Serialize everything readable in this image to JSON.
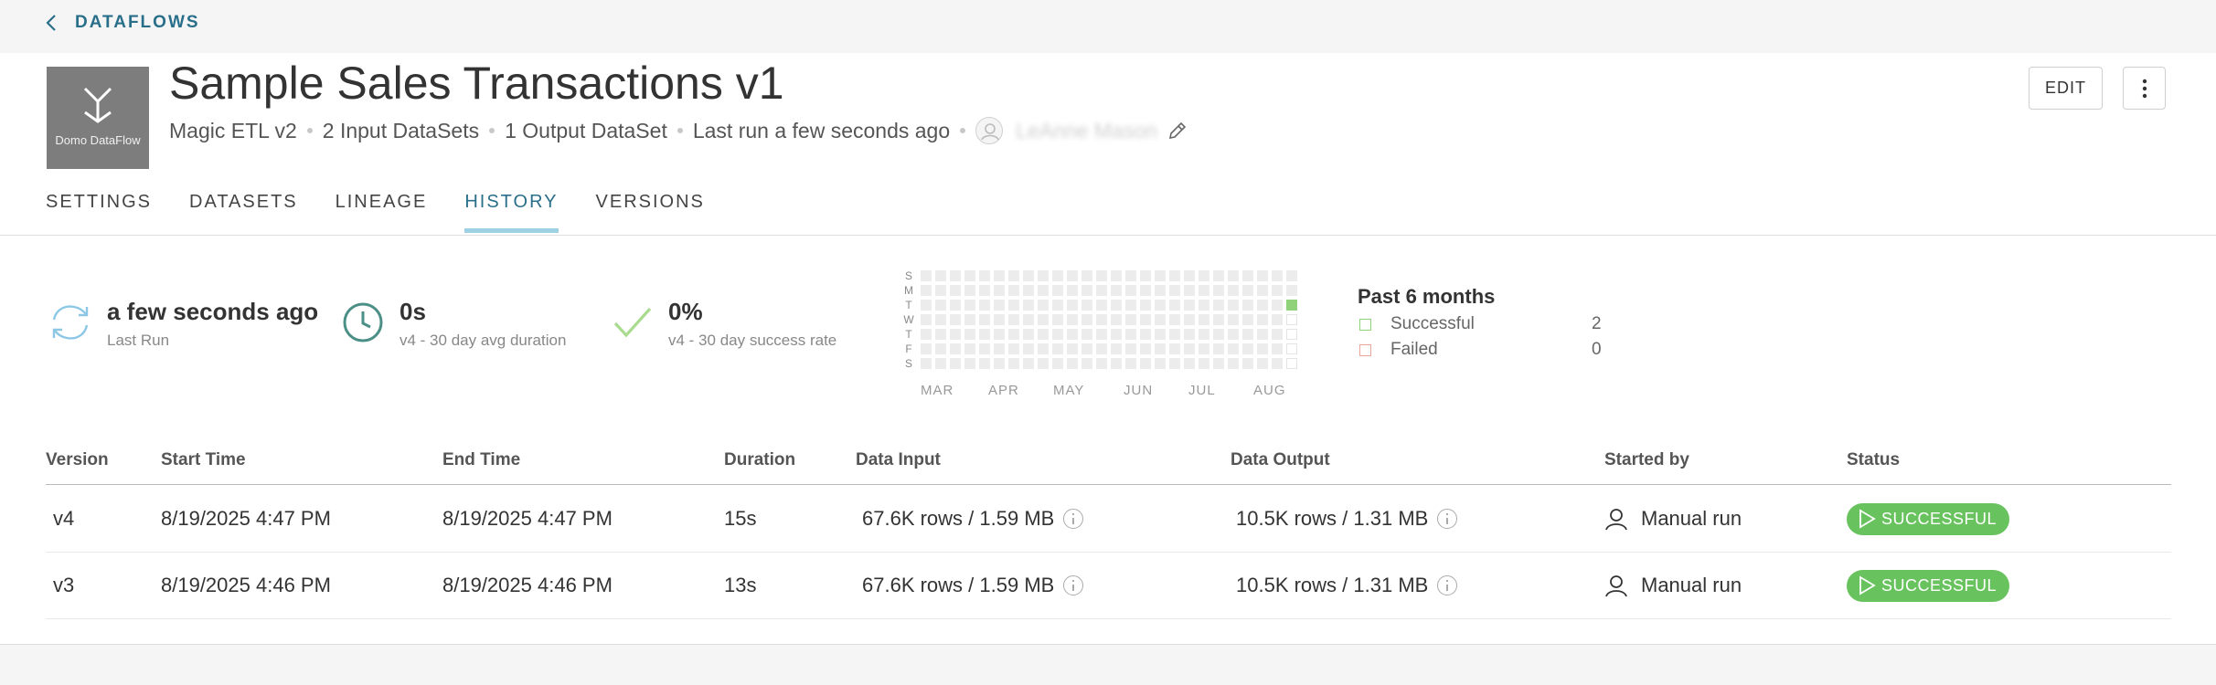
{
  "nav": {
    "back_label": "DATAFLOWS"
  },
  "dataflow": {
    "logo_caption": "Domo DataFlow",
    "title": "Sample Sales Transactions v1",
    "type": "Magic ETL v2",
    "inputs": "2 Input DataSets",
    "outputs": "1 Output DataSet",
    "last_run": "Last run a few seconds ago",
    "owner": "LeAnne Mason"
  },
  "actions": {
    "edit_label": "EDIT"
  },
  "tabs": [
    {
      "label": "SETTINGS",
      "active": false
    },
    {
      "label": "DATASETS",
      "active": false
    },
    {
      "label": "LINEAGE",
      "active": false
    },
    {
      "label": "HISTORY",
      "active": true
    },
    {
      "label": "VERSIONS",
      "active": false
    }
  ],
  "stats": {
    "last_run": {
      "value": "a few seconds ago",
      "caption": "Last Run"
    },
    "duration": {
      "value": "0s",
      "caption": "v4 - 30 day avg duration"
    },
    "success": {
      "value": "0%",
      "caption": "v4 - 30 day success rate"
    }
  },
  "calendar": {
    "day_labels": [
      "S",
      "M",
      "T",
      "W",
      "T",
      "F",
      "S"
    ],
    "month_labels": [
      "MAR",
      "APR",
      "MAY",
      "JUN",
      "JUL",
      "AUG"
    ],
    "weeks": 26,
    "successful_day": {
      "week": 25,
      "day": 2
    },
    "future_days_start": {
      "week": 25,
      "day": 3
    }
  },
  "legend": {
    "title": "Past 6 months",
    "items": [
      {
        "label": "Successful",
        "count": "2",
        "color": "#8fd27a"
      },
      {
        "label": "Failed",
        "count": "0",
        "color": "#e8a79a"
      }
    ]
  },
  "table": {
    "headers": {
      "version": "Version",
      "start": "Start Time",
      "end": "End Time",
      "duration": "Duration",
      "input": "Data Input",
      "output": "Data Output",
      "started_by": "Started by",
      "status": "Status"
    },
    "rows": [
      {
        "version": "v4",
        "start": "8/19/2025 4:47 PM",
        "end": "8/19/2025 4:47 PM",
        "duration": "15s",
        "input": "67.6K rows / 1.59 MB",
        "output": "10.5K rows / 1.31 MB",
        "started_by": "Manual run",
        "status": "SUCCESSFUL"
      },
      {
        "version": "v3",
        "start": "8/19/2025 4:46 PM",
        "end": "8/19/2025 4:46 PM",
        "duration": "13s",
        "input": "67.6K rows / 1.59 MB",
        "output": "10.5K rows / 1.31 MB",
        "started_by": "Manual run",
        "status": "SUCCESSFUL"
      }
    ]
  },
  "colors": {
    "accent": "#2a6f8a",
    "tab_underline": "#9ed1e4",
    "success": "#68c35e"
  }
}
